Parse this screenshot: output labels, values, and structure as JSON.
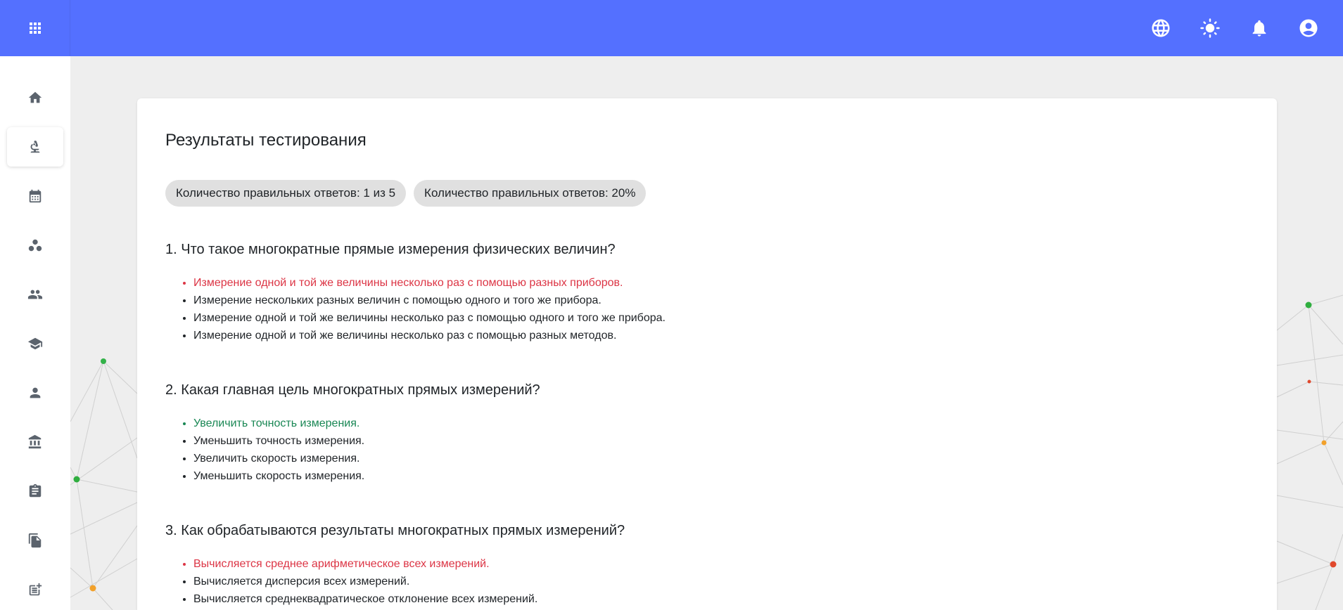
{
  "theme": {
    "primary": "#5470ff",
    "wrong": "#dc3545",
    "correct": "#198754",
    "background": "#eeeeee"
  },
  "header": {
    "menu_icon": "apps-icon",
    "actions": [
      {
        "icon": "language-icon"
      },
      {
        "icon": "light-mode-icon"
      },
      {
        "icon": "notifications-icon"
      },
      {
        "icon": "account-circle-icon"
      }
    ]
  },
  "sidebar": {
    "items": [
      {
        "icon": "home-icon",
        "selected": false
      },
      {
        "icon": "microscope-icon",
        "selected": true
      },
      {
        "icon": "calendar-icon",
        "selected": false
      },
      {
        "icon": "workspaces-icon",
        "selected": false
      },
      {
        "icon": "group-icon",
        "selected": false
      },
      {
        "icon": "school-icon",
        "selected": false
      },
      {
        "icon": "person-icon",
        "selected": false
      },
      {
        "icon": "institution-icon",
        "selected": false
      },
      {
        "icon": "assignment-icon",
        "selected": false
      },
      {
        "icon": "file-copy-icon",
        "selected": false
      },
      {
        "icon": "post-add-icon",
        "selected": false
      }
    ]
  },
  "results": {
    "title": "Результаты тестирования",
    "chips": [
      "Количество правильных ответов: 1 из 5",
      "Количество правильных ответов: 20%"
    ],
    "questions": [
      {
        "title": "1. Что такое многократные прямые измерения физических величин?",
        "answers": [
          {
            "text": "Измерение одной и той же величины несколько раз с помощью разных приборов.",
            "chosen": true,
            "correct": false
          },
          {
            "text": "Измерение нескольких разных величин с помощью одного и того же прибора.",
            "chosen": false
          },
          {
            "text": "Измерение одной и той же величины несколько раз с помощью одного и того же прибора.",
            "chosen": false
          },
          {
            "text": "Измерение одной и той же величины несколько раз с помощью разных методов.",
            "chosen": false
          }
        ]
      },
      {
        "title": "2. Какая главная цель многократных прямых измерений?",
        "answers": [
          {
            "text": "Увеличить точность измерения.",
            "chosen": true,
            "correct": true
          },
          {
            "text": "Уменьшить точность измерения.",
            "chosen": false
          },
          {
            "text": "Увеличить скорость измерения.",
            "chosen": false
          },
          {
            "text": "Уменьшить скорость измерения.",
            "chosen": false
          }
        ]
      },
      {
        "title": "3. Как обрабатываются результаты многократных прямых измерений?",
        "answers": [
          {
            "text": "Вычисляется среднее арифметическое всех измерений.",
            "chosen": true,
            "correct": false
          },
          {
            "text": "Вычисляется дисперсия всех измерений.",
            "chosen": false
          },
          {
            "text": "Вычисляется среднеквадратическое отклонение всех измерений.",
            "chosen": false
          }
        ]
      }
    ]
  }
}
